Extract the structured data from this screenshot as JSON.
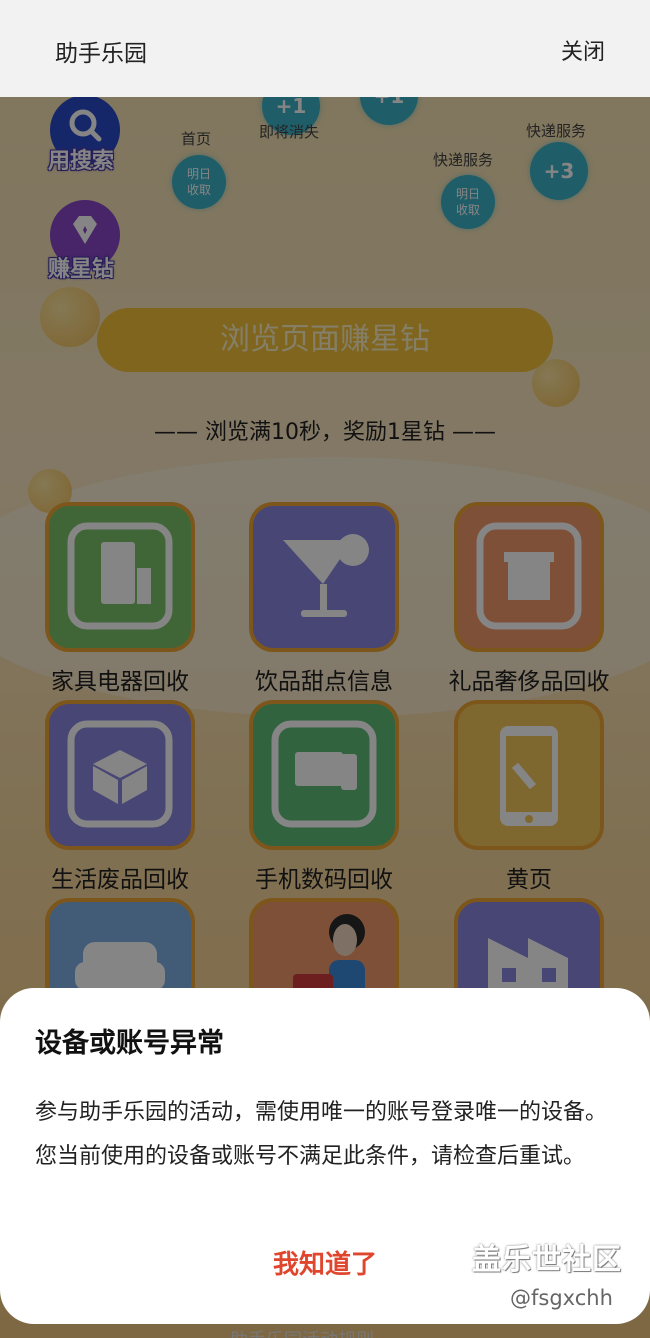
{
  "header": {
    "title": "助手乐园",
    "close_label": "关闭"
  },
  "side_buttons": [
    {
      "label": "用搜索",
      "icon": "search-icon"
    },
    {
      "label": "赚星钻",
      "icon": "diamond-icon"
    }
  ],
  "bubbles": [
    {
      "caption": "首页",
      "text": "明日\n收取"
    },
    {
      "caption": "即将消失",
      "text": "+1"
    },
    {
      "caption": "",
      "text": "+1"
    },
    {
      "caption": "快递服务",
      "text": "明日\n收取"
    },
    {
      "caption": "快递服务",
      "text": "+3"
    }
  ],
  "cta": {
    "label": "浏览页面赚星钻",
    "reward_note": "—— 浏览满10秒，奖励1星钻 ——"
  },
  "grid": [
    {
      "label": "家具电器回收",
      "icon": "fridge-recycle-icon",
      "color": "#7cc36a"
    },
    {
      "label": "饮品甜点信息",
      "icon": "cocktail-icon",
      "color": "#8b86e0"
    },
    {
      "label": "礼品奢侈品回收",
      "icon": "gift-recycle-icon",
      "color": "#f29a6a"
    },
    {
      "label": "生活废品回收",
      "icon": "box-recycle-icon",
      "color": "#8b86e0"
    },
    {
      "label": "手机数码回收",
      "icon": "device-recycle-icon",
      "color": "#5fbf7a"
    },
    {
      "label": "黄页",
      "icon": "phone-wrench-icon",
      "color": "#f2c85a"
    },
    {
      "label": "",
      "icon": "sofa-icon",
      "color": "#7fb0e6"
    },
    {
      "label": "",
      "icon": "housekeeper-icon",
      "color": "#f29a6a"
    },
    {
      "label": "",
      "icon": "building-icon",
      "color": "#8b86e0"
    }
  ],
  "dialog": {
    "title": "设备或账号异常",
    "body": "参与助手乐园的活动，需使用唯一的账号登录唯一的设备。您当前使用的设备或账号不满足此条件，请检查后重试。",
    "confirm_label": "我知道了"
  },
  "watermark": {
    "main": "盖乐世社区",
    "sub": "@fsgxchh"
  },
  "bottom_hint": "助手乐园活动规则"
}
